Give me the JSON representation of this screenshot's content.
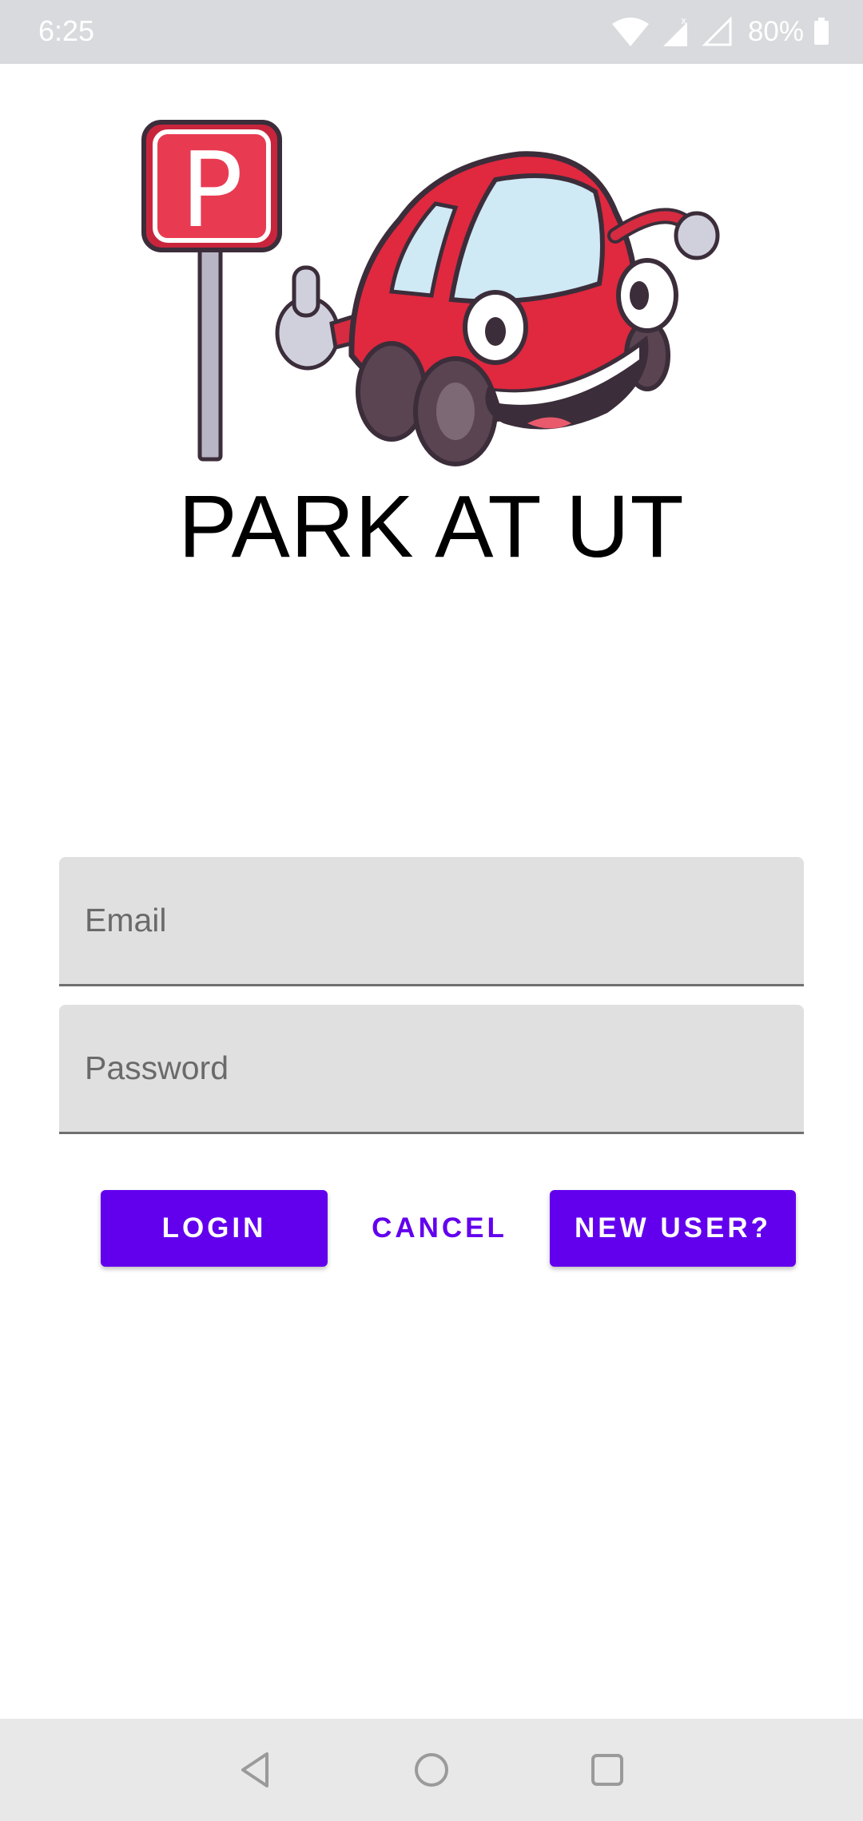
{
  "status_bar": {
    "time": "6:25",
    "battery": "80%"
  },
  "app": {
    "title": "PARK AT UT",
    "logo_icon": "parking-sign-and-car-icon"
  },
  "form": {
    "email_placeholder": "Email",
    "email_value": "",
    "password_placeholder": "Password",
    "password_value": ""
  },
  "buttons": {
    "login": "LOGIN",
    "cancel": "CANCEL",
    "new_user": "NEW USER?"
  },
  "colors": {
    "accent": "#6200ee",
    "field_background": "#e0e0e0",
    "status_bar": "#d9dadd"
  }
}
